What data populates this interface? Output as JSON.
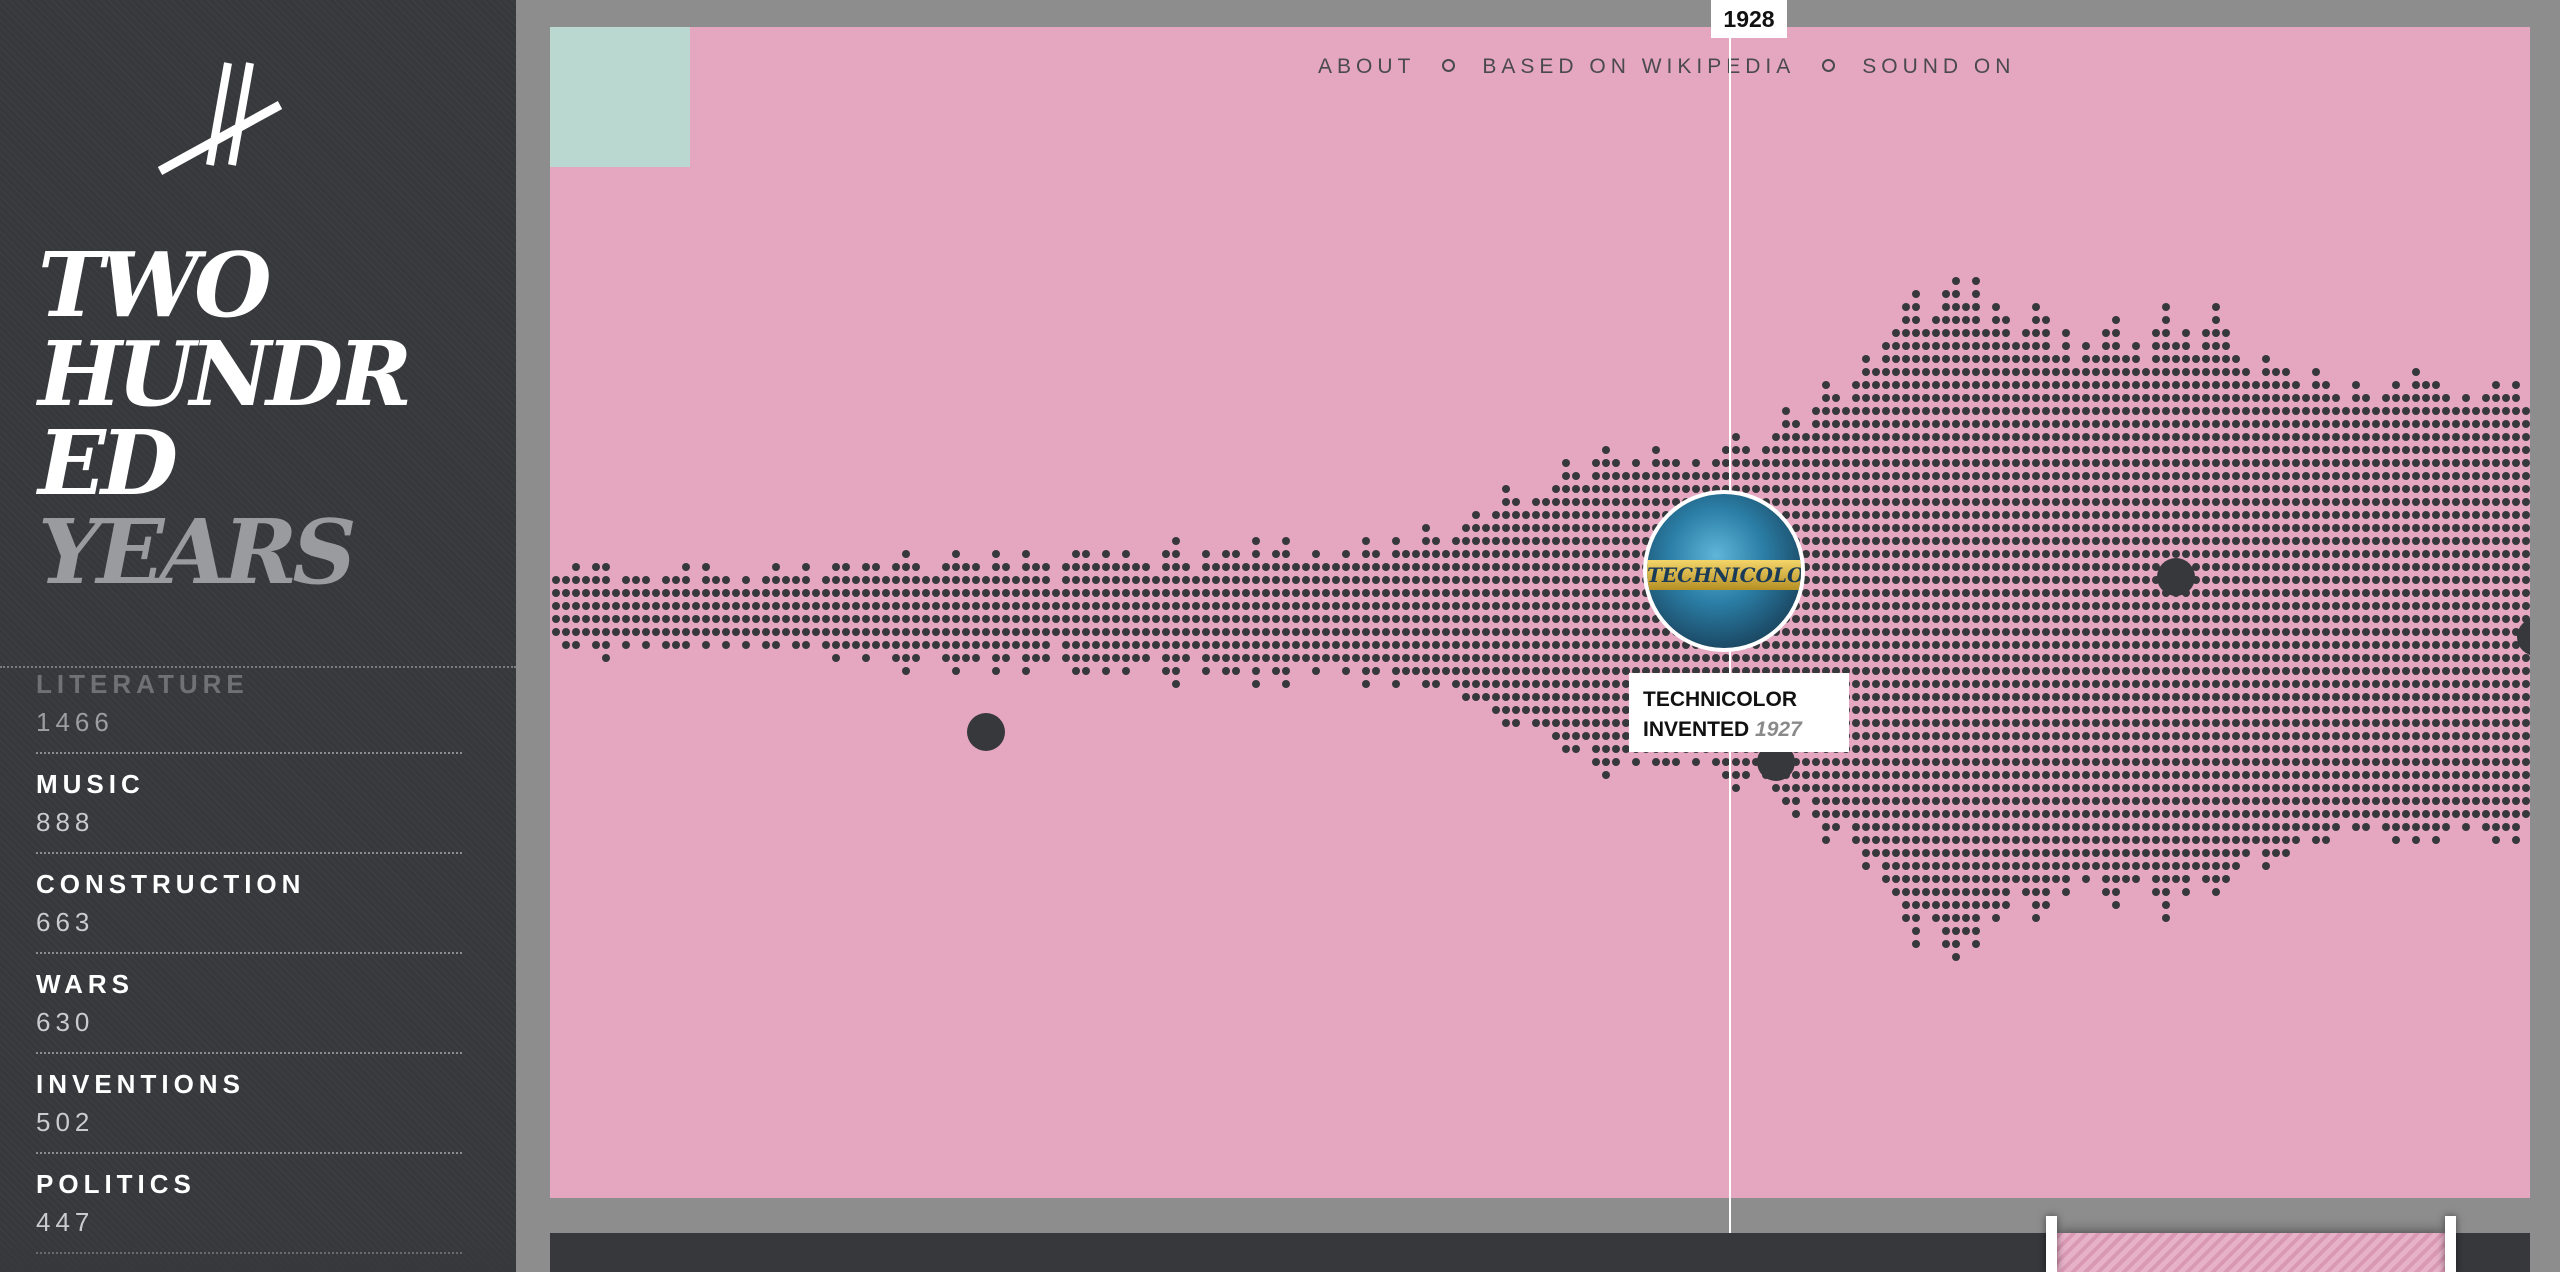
{
  "app": {
    "title_lines": [
      "TWO",
      "HUNDR",
      "ED"
    ],
    "title_highlight": "YEARS"
  },
  "nav": {
    "items": [
      "ABOUT",
      "BASED ON WIKIPEDIA",
      "SOUND ON"
    ]
  },
  "categories": [
    {
      "name": "LITERATURE",
      "count": "1466"
    },
    {
      "name": "MUSIC",
      "count": "888"
    },
    {
      "name": "CONSTRUCTION",
      "count": "663"
    },
    {
      "name": "WARS",
      "count": "630"
    },
    {
      "name": "INVENTIONS",
      "count": "502"
    },
    {
      "name": "POLITICS",
      "count": "447"
    }
  ],
  "timeline": {
    "current_year": "1928"
  },
  "event": {
    "title_line1": "TECHNICOLOR",
    "title_line2": "INVENTED",
    "year": "1927",
    "thumbnail_text": "TECHNICOLOR"
  },
  "colors": {
    "sidebar_bg": "#36383c",
    "panel_bg": "#e5a7c0",
    "corner_accent": "#bad8cf",
    "dot": "#37383c",
    "frame": "#8d8d8d"
  },
  "chart_data": {
    "type": "scatter",
    "description_of_marks": "stacked dot columns per year, mirrored above and below a center baseline",
    "x_range": [
      1815,
      2014
    ],
    "columns_up": [
      3,
      3,
      4,
      3,
      4,
      4,
      2,
      3,
      3,
      3,
      2,
      3,
      3,
      4,
      2,
      4,
      3,
      3,
      2,
      3,
      2,
      3,
      4,
      3,
      3,
      4,
      2,
      3,
      4,
      4,
      3,
      4,
      4,
      3,
      4,
      5,
      4,
      3,
      3,
      4,
      5,
      4,
      4,
      3,
      5,
      4,
      3,
      5,
      4,
      4,
      2,
      4,
      5,
      5,
      4,
      5,
      4,
      5,
      4,
      4,
      3,
      5,
      6,
      4,
      3,
      5,
      4,
      5,
      5,
      4,
      6,
      4,
      5,
      6,
      4,
      4,
      5,
      4,
      4,
      5,
      4,
      6,
      5,
      4,
      6,
      5,
      5,
      7,
      6,
      5,
      6,
      7,
      8,
      7,
      8,
      10,
      9,
      8,
      9,
      9,
      10,
      12,
      11,
      10,
      12,
      13,
      12,
      11,
      12,
      11,
      13,
      12,
      12,
      11,
      12,
      11,
      12,
      13,
      14,
      13,
      12,
      13,
      14,
      16,
      15,
      14,
      16,
      18,
      17,
      16,
      18,
      20,
      19,
      21,
      22,
      24,
      25,
      22,
      23,
      25,
      26,
      24,
      26,
      22,
      24,
      23,
      21,
      22,
      24,
      23,
      20,
      22,
      19,
      21,
      20,
      22,
      23,
      20,
      21,
      19,
      22,
      24,
      21,
      22,
      20,
      22,
      24,
      22,
      20,
      19,
      18,
      20,
      19,
      19,
      18,
      17,
      19,
      18,
      17,
      16,
      18,
      17,
      16,
      17,
      18,
      17,
      19,
      18,
      18,
      17,
      16,
      17,
      16,
      17,
      18,
      17,
      18,
      16,
      15,
      17
    ],
    "columns_down": [
      2,
      3,
      3,
      2,
      3,
      4,
      2,
      3,
      2,
      3,
      2,
      3,
      3,
      3,
      2,
      3,
      2,
      3,
      2,
      3,
      2,
      3,
      3,
      2,
      3,
      3,
      2,
      3,
      4,
      3,
      3,
      4,
      3,
      3,
      4,
      5,
      4,
      3,
      3,
      4,
      5,
      4,
      4,
      3,
      5,
      4,
      3,
      5,
      4,
      4,
      2,
      4,
      5,
      5,
      4,
      5,
      4,
      5,
      4,
      4,
      3,
      5,
      6,
      4,
      3,
      5,
      4,
      5,
      5,
      4,
      6,
      4,
      5,
      6,
      4,
      4,
      5,
      4,
      4,
      5,
      4,
      6,
      5,
      4,
      6,
      5,
      5,
      6,
      6,
      5,
      6,
      7,
      7,
      7,
      8,
      9,
      9,
      8,
      9,
      9,
      10,
      11,
      11,
      10,
      12,
      13,
      12,
      11,
      12,
      11,
      12,
      12,
      12,
      11,
      12,
      11,
      12,
      13,
      14,
      13,
      12,
      13,
      14,
      15,
      16,
      14,
      16,
      18,
      17,
      16,
      18,
      20,
      19,
      21,
      22,
      24,
      26,
      23,
      24,
      26,
      27,
      25,
      26,
      23,
      24,
      23,
      21,
      22,
      24,
      23,
      21,
      22,
      20,
      21,
      20,
      22,
      23,
      21,
      21,
      20,
      22,
      24,
      21,
      22,
      20,
      21,
      22,
      21,
      20,
      19,
      18,
      20,
      19,
      19,
      18,
      17,
      18,
      18,
      17,
      16,
      17,
      17,
      16,
      17,
      18,
      17,
      18,
      17,
      18,
      17,
      16,
      17,
      16,
      17,
      18,
      17,
      18,
      16,
      15,
      17
    ],
    "highlighted_years": [
      1858,
      1927,
      1937,
      1977,
      2013
    ]
  }
}
